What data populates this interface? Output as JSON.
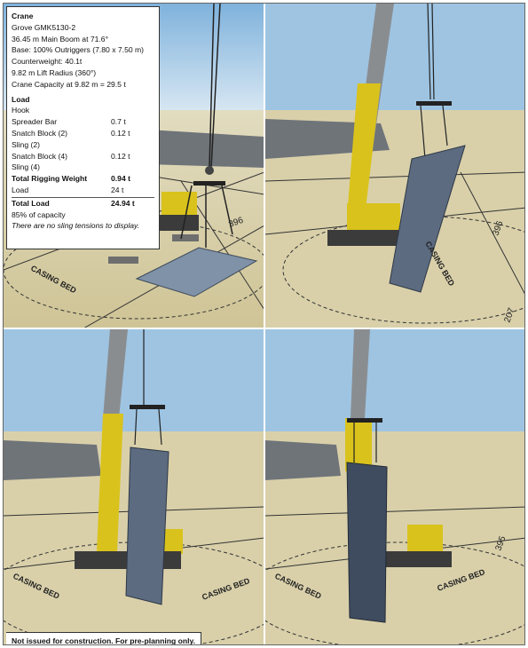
{
  "info": {
    "crane_header": "Crane",
    "crane_model": "Grove GMK5130-2",
    "main_boom": "36.45 m Main Boom at 71.6°",
    "base": "Base: 100% Outriggers (7.80 x 7.50 m)",
    "counterweight": "Counterweight: 40.1t",
    "lift_radius": "9.82 m Lift Radius (360°)",
    "crane_capacity": "Crane Capacity at 9.82 m = 29.5 t",
    "load_header": "Load",
    "rows": [
      {
        "k": "Hook",
        "v": ""
      },
      {
        "k": "Spreader Bar",
        "v": "0.7 t"
      },
      {
        "k": "Snatch Block (2)",
        "v": "0.12 t"
      },
      {
        "k": "Sling (2)",
        "v": ""
      },
      {
        "k": "Snatch Block (4)",
        "v": "0.12 t"
      },
      {
        "k": "Sling (4)",
        "v": ""
      }
    ],
    "total_rigging_label": "Total Rigging Weight",
    "total_rigging_value": "0.94 t",
    "load_label": "Load",
    "load_value": "24 t",
    "total_load_label": "Total Load",
    "total_load_value": "24.94 t",
    "capacity_pct": "85% of capacity",
    "tension_note": "There are no sling tensions to display."
  },
  "ground_labels": {
    "casing_bed": "CASING BED",
    "dim_396": "396",
    "dim_395": "395",
    "dim_207": "207"
  },
  "footer_note": "Not issued for construction. For pre-planning only.",
  "colors": {
    "sky": "#a9cbe6",
    "ground": "#d8cfa8",
    "crane_yellow": "#d9c21c",
    "boom_grey": "#8a8d90",
    "panel_blue": "#5c6b80",
    "aircraft_grey": "#6f7479"
  }
}
